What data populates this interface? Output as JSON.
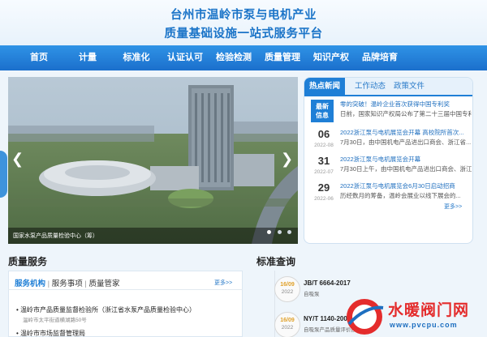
{
  "header": {
    "title_line1": "台州市温岭市泵与电机产业",
    "title_line2": "质量基础设施一站式服务平台"
  },
  "nav": {
    "items": [
      "首页",
      "计量",
      "标准化",
      "认证认可",
      "检验检测",
      "质量管理",
      "知识产权",
      "品牌培育"
    ]
  },
  "banner": {
    "caption": "国家水泵产品质量检验中心（筹）",
    "prev_glyph": "❮",
    "next_glyph": "❯",
    "active_dot": 1
  },
  "news": {
    "tabs": [
      "热点新闻",
      "工作动态",
      "政策文件"
    ],
    "featured": {
      "badge_line1": "最新",
      "badge_line2": "信息",
      "title": "零的突破！温岭企业首次获得中国专利奖",
      "snippet": "日前，国家知识产权局公布了第二十三届中国专利..."
    },
    "items": [
      {
        "day": "06",
        "ym": "2022-08",
        "title": "2022浙江泵与电机展览会开幕 高校院所首次...",
        "snippet": "7月30日，由中国机电产品进出口商会、浙江省..."
      },
      {
        "day": "31",
        "ym": "2022-07",
        "title": "2022浙江泵与电机展览会开幕",
        "snippet": "7月30日上午，由中国机电产品进出口商会、浙江..."
      },
      {
        "day": "29",
        "ym": "2022-06",
        "title": "2022浙江泵与电机展览会6月30日启动招商",
        "snippet": "历经数月的筹备，温岭会展业以线下展会的..."
      }
    ],
    "more": "更多>>"
  },
  "quality_service": {
    "title": "质量服务",
    "tabs": [
      "服务机构",
      "服务事项",
      "质量管家"
    ],
    "separator": "|",
    "more": "更多>>",
    "items": [
      {
        "name": "温岭市产品质量监督检验所（浙江省水泵产品质量检验中心）",
        "address": "温岭市太平街道横湖路50号"
      },
      {
        "name": "温岭市市场监督管理局",
        "address": ""
      }
    ]
  },
  "standard_query": {
    "title": "标准查询",
    "items": [
      {
        "date": "16/09",
        "year": "2022",
        "code": "JB/T 6664-2017",
        "name": "自吸泵"
      },
      {
        "date": "16/09",
        "year": "2022",
        "code": "NY/T 1140-2006",
        "name": "自吸泵产品质量评价技术规范"
      }
    ]
  },
  "watermark": {
    "text": "水暖阀门网",
    "url": "www.pvcpu.com",
    "logo_letter": "P"
  },
  "colors": {
    "brand_blue": "#1f7fd6",
    "nav_top": "#2f93e6",
    "accent_orange": "#e0a12a",
    "watermark_red": "#e42c2c"
  }
}
